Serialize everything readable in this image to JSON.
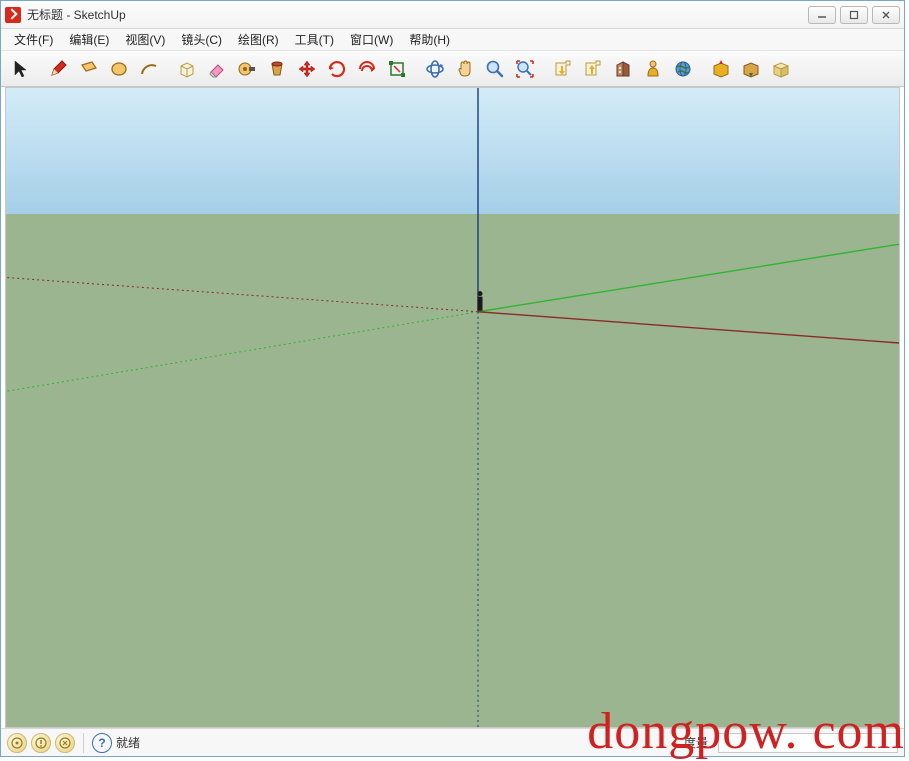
{
  "title": "无标题 - SketchUp",
  "menus": [
    "文件(F)",
    "编辑(E)",
    "视图(V)",
    "镜头(C)",
    "绘图(R)",
    "工具(T)",
    "窗口(W)",
    "帮助(H)"
  ],
  "tools": [
    {
      "name": "select-tool",
      "icon": "cursor"
    },
    {
      "sep": true
    },
    {
      "name": "pencil-tool",
      "icon": "pencil"
    },
    {
      "name": "rectangle-tool",
      "icon": "rectangle"
    },
    {
      "name": "circle-tool",
      "icon": "circle"
    },
    {
      "name": "arc-tool",
      "icon": "arc"
    },
    {
      "sep": true
    },
    {
      "name": "pushpull-tool",
      "icon": "box"
    },
    {
      "name": "eraser-tool",
      "icon": "eraser"
    },
    {
      "name": "tape-tool",
      "icon": "tape"
    },
    {
      "name": "paint-tool",
      "icon": "bucket"
    },
    {
      "name": "move-tool",
      "icon": "move"
    },
    {
      "name": "rotate-tool",
      "icon": "rotate"
    },
    {
      "name": "offset-tool",
      "icon": "offset"
    },
    {
      "name": "scale-tool",
      "icon": "scale"
    },
    {
      "sep": true
    },
    {
      "name": "orbit-tool",
      "icon": "orbit"
    },
    {
      "name": "pan-tool",
      "icon": "hand"
    },
    {
      "name": "zoom-tool",
      "icon": "zoom"
    },
    {
      "name": "zoomextents-tool",
      "icon": "zoomext"
    },
    {
      "sep": true
    },
    {
      "name": "getmodels-tool",
      "icon": "download"
    },
    {
      "name": "sharemodel-tool",
      "icon": "upload"
    },
    {
      "name": "building-tool",
      "icon": "building"
    },
    {
      "name": "person-tool",
      "icon": "person"
    },
    {
      "name": "globe-tool",
      "icon": "globe"
    },
    {
      "sep": true
    },
    {
      "name": "extension1-tool",
      "icon": "ext1"
    },
    {
      "name": "extension2-tool",
      "icon": "ext2"
    },
    {
      "name": "extension3-tool",
      "icon": "ext3"
    }
  ],
  "status": {
    "ready": "就绪",
    "measure_label": "度量"
  },
  "watermark": "dongpow. com",
  "colors": {
    "sky_top": "#d3ecf7",
    "sky_bottom": "#a5cfe8",
    "ground": "#9ab58f",
    "axis_blue": "#1a3c7a",
    "axis_green": "#2fb52f",
    "axis_red": "#a52a2a"
  }
}
